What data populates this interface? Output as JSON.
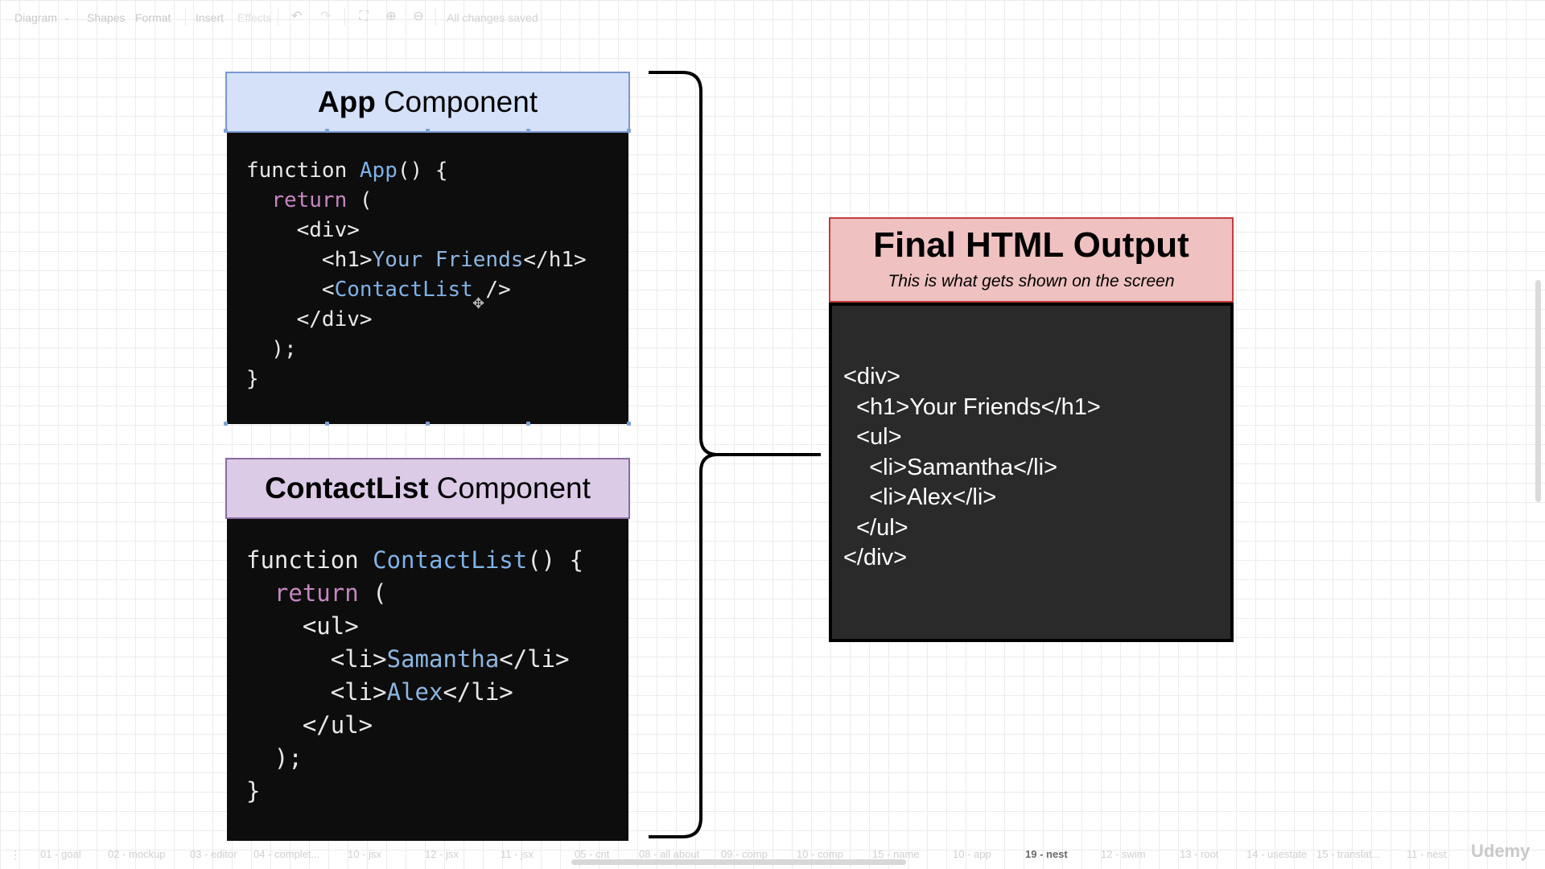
{
  "toolbar": {
    "diagram": "Diagram",
    "shapes": "Shapes",
    "format": "Format",
    "insert": "Insert",
    "effects": "Effects",
    "status": "All changes saved"
  },
  "app_component": {
    "title_bold": "App",
    "title_rest": "Component",
    "colors": {
      "header_bg": "#d4e1f8",
      "header_border": "#7a97cf"
    },
    "code": [
      [
        {
          "t": "function ",
          "c": "tag"
        },
        {
          "t": "App",
          "c": "fn"
        },
        {
          "t": "() {",
          "c": "tag"
        }
      ],
      [
        {
          "t": "  ",
          "c": "tag"
        },
        {
          "t": "return",
          "c": "kw"
        },
        {
          "t": " (",
          "c": "tag"
        }
      ],
      [
        {
          "t": "    <div>",
          "c": "tag"
        }
      ],
      [
        {
          "t": "      <h1>",
          "c": "tag"
        },
        {
          "t": "Your Friends",
          "c": "tx"
        },
        {
          "t": "</h1>",
          "c": "tag"
        }
      ],
      [
        {
          "t": "      <",
          "c": "tag"
        },
        {
          "t": "ContactList",
          "c": "fn"
        },
        {
          "t": " />",
          "c": "tag"
        }
      ],
      [
        {
          "t": "    </div>",
          "c": "tag"
        }
      ],
      [
        {
          "t": "  );",
          "c": "tag"
        }
      ],
      [
        {
          "t": "}",
          "c": "tag"
        }
      ]
    ]
  },
  "contactlist_component": {
    "title_bold": "ContactList",
    "title_rest": "Component",
    "colors": {
      "header_bg": "#dccbe6",
      "header_border": "#8a6aa0"
    },
    "code": [
      [
        {
          "t": "function ",
          "c": "tag"
        },
        {
          "t": "ContactList",
          "c": "fn"
        },
        {
          "t": "() {",
          "c": "tag"
        }
      ],
      [
        {
          "t": "  ",
          "c": "tag"
        },
        {
          "t": "return",
          "c": "kw"
        },
        {
          "t": " (",
          "c": "tag"
        }
      ],
      [
        {
          "t": "    <ul>",
          "c": "tag"
        }
      ],
      [
        {
          "t": "      <li>",
          "c": "tag"
        },
        {
          "t": "Samantha",
          "c": "tx"
        },
        {
          "t": "</li>",
          "c": "tag"
        }
      ],
      [
        {
          "t": "      <li>",
          "c": "tag"
        },
        {
          "t": "Alex",
          "c": "tx"
        },
        {
          "t": "</li>",
          "c": "tag"
        }
      ],
      [
        {
          "t": "    </ul>",
          "c": "tag"
        }
      ],
      [
        {
          "t": "  );",
          "c": "tag"
        }
      ],
      [
        {
          "t": "}",
          "c": "tag"
        }
      ]
    ]
  },
  "final_output": {
    "title": "Final HTML Output",
    "subtitle": "This is what gets shown on the screen",
    "lines": [
      "<div>",
      "  <h1>Your Friends</h1>",
      "  <ul>",
      "    <li>Samantha</li>",
      "    <li>Alex</li>",
      "  </ul>",
      "</div>"
    ]
  },
  "page_tabs": [
    "01 - goal",
    "02 - mockup",
    "03 - editor",
    "04 - complet...",
    "10 - jsx",
    "12 - jsx",
    "11 - jsx",
    "05 - cnt",
    "08 - all about",
    "09 - comp",
    "10 - comp",
    "15 - name",
    "10 - app",
    "19 - nest",
    "12 - swim",
    "13 - root",
    "14 - usestate",
    "15 - translat...",
    "11 - nest"
  ],
  "active_tab": "19 - nest",
  "watermark": "Udemy"
}
